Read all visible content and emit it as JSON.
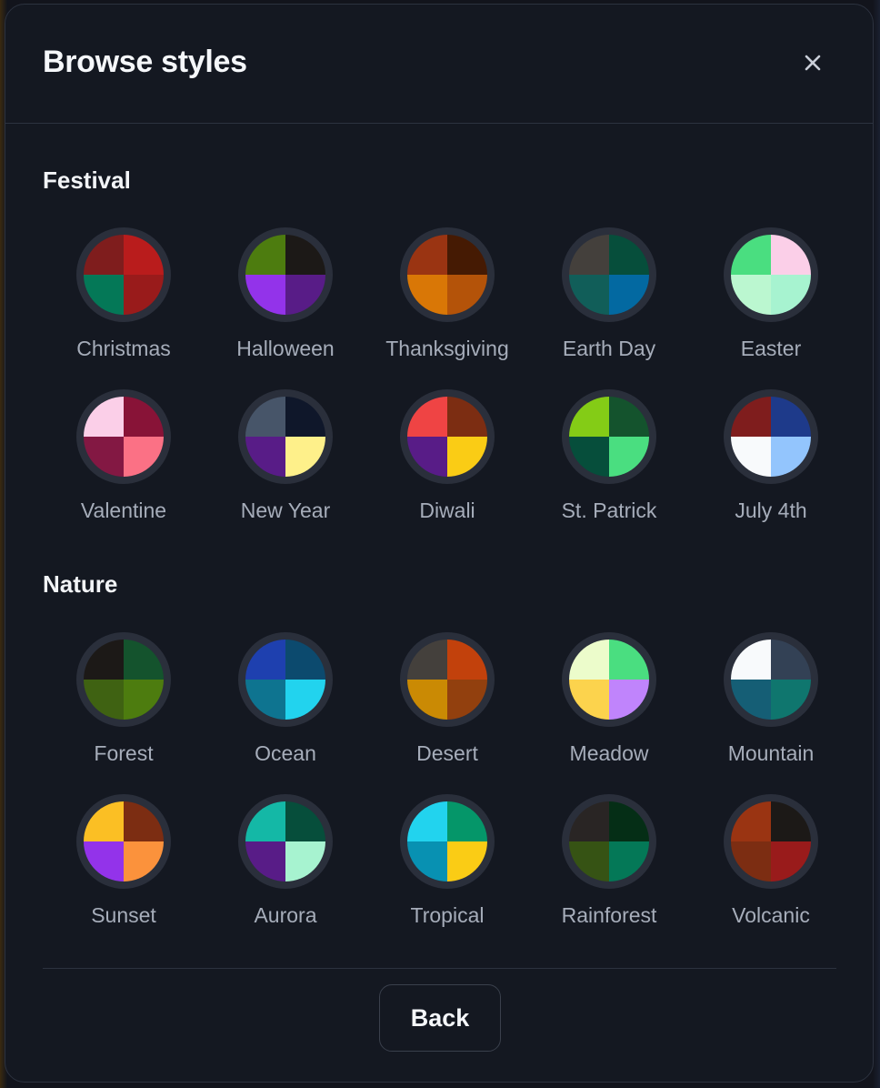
{
  "dialog": {
    "title": "Browse styles",
    "close_icon": "close-icon",
    "back_label": "Back"
  },
  "sections": [
    {
      "title": "Festival",
      "styles": [
        {
          "name": "Christmas",
          "colors": [
            "#7f1d1d",
            "#b91c1c",
            "#047857",
            "#991b1b"
          ]
        },
        {
          "name": "Halloween",
          "colors": [
            "#4d7c0f",
            "#1c1917",
            "#9333ea",
            "#581c87"
          ]
        },
        {
          "name": "Thanksgiving",
          "colors": [
            "#9a3412",
            "#451a03",
            "#d97706",
            "#b45309"
          ]
        },
        {
          "name": "Earth Day",
          "colors": [
            "#44403c",
            "#064e3b",
            "#115e59",
            "#0369a1"
          ]
        },
        {
          "name": "Easter",
          "colors": [
            "#4ade80",
            "#fbcfe8",
            "#bbf7d0",
            "#a7f3d0"
          ]
        },
        {
          "name": "Valentine",
          "colors": [
            "#fbcfe8",
            "#881337",
            "#831843",
            "#fb7185"
          ]
        },
        {
          "name": "New Year",
          "colors": [
            "#475569",
            "#0f172a",
            "#581c87",
            "#fef08a"
          ]
        },
        {
          "name": "Diwali",
          "colors": [
            "#ef4444",
            "#7c2d12",
            "#581c87",
            "#facc15"
          ]
        },
        {
          "name": "St. Patrick",
          "colors": [
            "#84cc16",
            "#14532d",
            "#064e3b",
            "#4ade80"
          ]
        },
        {
          "name": "July 4th",
          "colors": [
            "#7f1d1d",
            "#1e3a8a",
            "#f8fafc",
            "#93c5fd"
          ]
        }
      ]
    },
    {
      "title": "Nature",
      "styles": [
        {
          "name": "Forest",
          "colors": [
            "#1c1917",
            "#14532d",
            "#3f6212",
            "#4d7c0f"
          ]
        },
        {
          "name": "Ocean",
          "colors": [
            "#1e40af",
            "#0c4a6e",
            "#0e7490",
            "#22d3ee"
          ]
        },
        {
          "name": "Desert",
          "colors": [
            "#44403c",
            "#c2410c",
            "#ca8a04",
            "#92400e"
          ]
        },
        {
          "name": "Meadow",
          "colors": [
            "#ecfccb",
            "#4ade80",
            "#fcd34d",
            "#c084fc"
          ]
        },
        {
          "name": "Mountain",
          "colors": [
            "#f8fafc",
            "#334155",
            "#155e75",
            "#0f766e"
          ]
        },
        {
          "name": "Sunset",
          "colors": [
            "#fbbf24",
            "#7c2d12",
            "#9333ea",
            "#fb923c"
          ]
        },
        {
          "name": "Aurora",
          "colors": [
            "#14b8a6",
            "#064e3b",
            "#581c87",
            "#a7f3d0"
          ]
        },
        {
          "name": "Tropical",
          "colors": [
            "#22d3ee",
            "#059669",
            "#0891b2",
            "#facc15"
          ]
        },
        {
          "name": "Rainforest",
          "colors": [
            "#292524",
            "#052e16",
            "#365314",
            "#047857"
          ]
        },
        {
          "name": "Volcanic",
          "colors": [
            "#9a3412",
            "#1c1917",
            "#7c2d12",
            "#991b1b"
          ]
        }
      ]
    }
  ]
}
